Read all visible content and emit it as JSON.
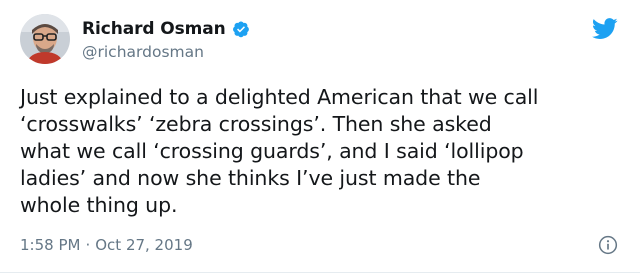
{
  "author": {
    "display_name": "Richard Osman",
    "handle": "@richardosman",
    "verified": true
  },
  "tweet": {
    "text_lines": [
      "Just explained to a delighted American that we call",
      "‘crosswalks’ ‘zebra crossings’. Then she asked",
      "what we call ‘crossing guards’, and I said ‘lollipop",
      "ladies’ and now she thinks I’ve just made the",
      "whole thing up."
    ],
    "time": "1:58 PM",
    "separator": "·",
    "date": "Oct 27, 2019"
  },
  "icons": {
    "brand": "twitter-bird-icon",
    "verified": "verified-badge-icon",
    "info": "info-icon"
  },
  "colors": {
    "brand_blue": "#1da1f2",
    "secondary_text": "#657786",
    "primary_text": "#14171a"
  }
}
